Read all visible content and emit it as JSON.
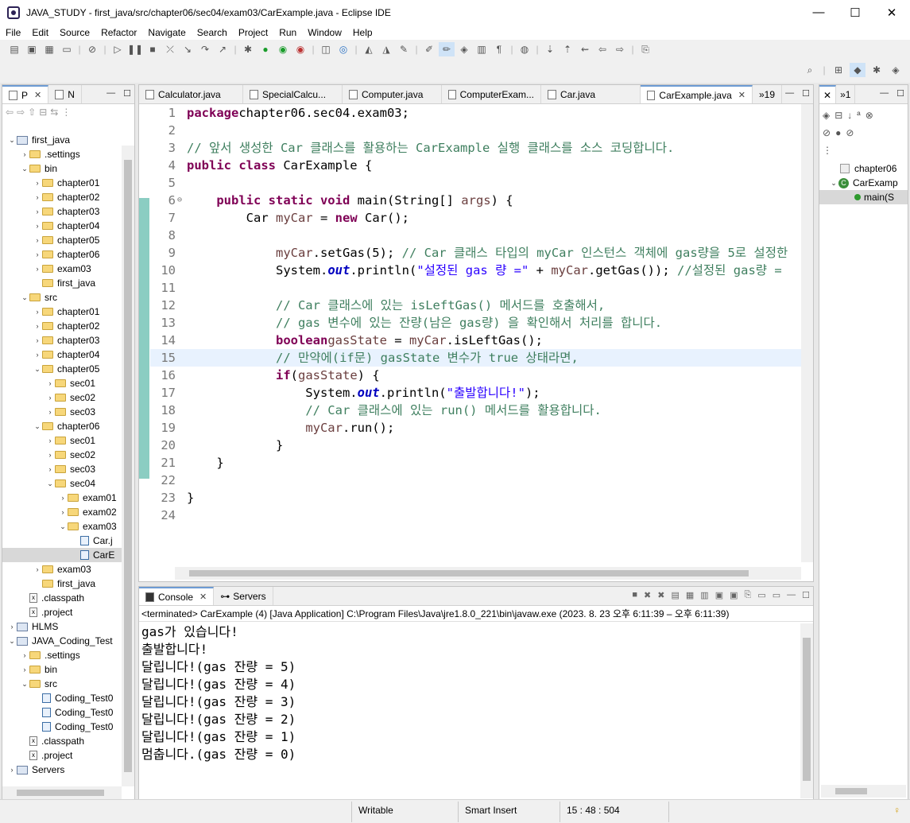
{
  "window": {
    "title": "JAVA_STUDY - first_java/src/chapter06/sec04/exam03/CarExample.java - Eclipse IDE",
    "minimize": "—",
    "maximize": "☐",
    "close": "✕"
  },
  "menu": [
    "File",
    "Edit",
    "Source",
    "Refactor",
    "Navigate",
    "Search",
    "Project",
    "Run",
    "Window",
    "Help"
  ],
  "explorer": {
    "tabs": [
      "P",
      "N"
    ],
    "tree": [
      {
        "label": "first_java",
        "indent": 0,
        "type": "project",
        "tw": "v"
      },
      {
        "label": ".settings",
        "indent": 1,
        "type": "folder",
        "tw": ">"
      },
      {
        "label": "bin",
        "indent": 1,
        "type": "folder",
        "tw": "v"
      },
      {
        "label": "chapter01",
        "indent": 2,
        "type": "folder",
        "tw": ">"
      },
      {
        "label": "chapter02",
        "indent": 2,
        "type": "folder",
        "tw": ">"
      },
      {
        "label": "chapter03",
        "indent": 2,
        "type": "folder",
        "tw": ">"
      },
      {
        "label": "chapter04",
        "indent": 2,
        "type": "folder",
        "tw": ">"
      },
      {
        "label": "chapter05",
        "indent": 2,
        "type": "folder",
        "tw": ">"
      },
      {
        "label": "chapter06",
        "indent": 2,
        "type": "folder",
        "tw": ">"
      },
      {
        "label": "exam03",
        "indent": 2,
        "type": "folder",
        "tw": ">"
      },
      {
        "label": "first_java",
        "indent": 2,
        "type": "folder",
        "tw": ""
      },
      {
        "label": "src",
        "indent": 1,
        "type": "folder",
        "tw": "v"
      },
      {
        "label": "chapter01",
        "indent": 2,
        "type": "folder",
        "tw": ">"
      },
      {
        "label": "chapter02",
        "indent": 2,
        "type": "folder",
        "tw": ">"
      },
      {
        "label": "chapter03",
        "indent": 2,
        "type": "folder",
        "tw": ">"
      },
      {
        "label": "chapter04",
        "indent": 2,
        "type": "folder",
        "tw": ">"
      },
      {
        "label": "chapter05",
        "indent": 2,
        "type": "folder",
        "tw": "v"
      },
      {
        "label": "sec01",
        "indent": 3,
        "type": "folder",
        "tw": ">"
      },
      {
        "label": "sec02",
        "indent": 3,
        "type": "folder",
        "tw": ">"
      },
      {
        "label": "sec03",
        "indent": 3,
        "type": "folder",
        "tw": ">"
      },
      {
        "label": "chapter06",
        "indent": 2,
        "type": "folder",
        "tw": "v"
      },
      {
        "label": "sec01",
        "indent": 3,
        "type": "folder",
        "tw": ">"
      },
      {
        "label": "sec02",
        "indent": 3,
        "type": "folder",
        "tw": ">"
      },
      {
        "label": "sec03",
        "indent": 3,
        "type": "folder",
        "tw": ">"
      },
      {
        "label": "sec04",
        "indent": 3,
        "type": "folder",
        "tw": "v"
      },
      {
        "label": "exam01",
        "indent": 4,
        "type": "folder",
        "tw": ">"
      },
      {
        "label": "exam02",
        "indent": 4,
        "type": "folder",
        "tw": ">"
      },
      {
        "label": "exam03",
        "indent": 4,
        "type": "folder",
        "tw": "v"
      },
      {
        "label": "Car.j",
        "indent": 5,
        "type": "java",
        "tw": ""
      },
      {
        "label": "CarE",
        "indent": 5,
        "type": "java",
        "tw": "",
        "selected": true
      },
      {
        "label": "exam03",
        "indent": 2,
        "type": "folder",
        "tw": ">"
      },
      {
        "label": "first_java",
        "indent": 2,
        "type": "folder",
        "tw": ""
      },
      {
        "label": ".classpath",
        "indent": 1,
        "type": "file",
        "tw": ""
      },
      {
        "label": ".project",
        "indent": 1,
        "type": "file",
        "tw": ""
      },
      {
        "label": "HLMS",
        "indent": 0,
        "type": "project",
        "tw": ">"
      },
      {
        "label": "JAVA_Coding_Test",
        "indent": 0,
        "type": "project",
        "tw": "v"
      },
      {
        "label": ".settings",
        "indent": 1,
        "type": "folder",
        "tw": ">"
      },
      {
        "label": "bin",
        "indent": 1,
        "type": "folder",
        "tw": ">"
      },
      {
        "label": "src",
        "indent": 1,
        "type": "folder",
        "tw": "v"
      },
      {
        "label": "Coding_Test0",
        "indent": 2,
        "type": "java",
        "tw": ""
      },
      {
        "label": "Coding_Test0",
        "indent": 2,
        "type": "java",
        "tw": ""
      },
      {
        "label": "Coding_Test0",
        "indent": 2,
        "type": "java",
        "tw": ""
      },
      {
        "label": ".classpath",
        "indent": 1,
        "type": "file",
        "tw": ""
      },
      {
        "label": ".project",
        "indent": 1,
        "type": "file",
        "tw": ""
      },
      {
        "label": "Servers",
        "indent": 0,
        "type": "project",
        "tw": ">"
      }
    ]
  },
  "editor": {
    "tabs": [
      {
        "label": "Calculator.java",
        "active": false
      },
      {
        "label": "SpecialCalcu...",
        "active": false
      },
      {
        "label": "Computer.java",
        "active": false
      },
      {
        "label": "ComputerExam...",
        "active": false
      },
      {
        "label": "Car.java",
        "active": false
      },
      {
        "label": "CarExample.java",
        "active": true
      }
    ],
    "overflow": "»19",
    "lines": [
      [
        [
          "kw",
          "package"
        ],
        [
          "",
          "chapter06.sec04.exam03;"
        ]
      ],
      [],
      [
        [
          "cm",
          "// 앞서 생성한 Car 클래스를 활용하는 CarExample 실행 클래스를 소스 코딩합니다."
        ]
      ],
      [
        [
          "kw",
          "public class"
        ],
        [
          "",
          " CarExample {"
        ]
      ],
      [],
      [
        [
          "",
          "    "
        ],
        [
          "kw",
          "public static void"
        ],
        [
          "",
          " main(String[] "
        ],
        [
          "vr",
          "args"
        ],
        [
          "",
          ") {"
        ]
      ],
      [
        [
          "",
          "        Car "
        ],
        [
          "vr",
          "myCar"
        ],
        [
          "",
          " = "
        ],
        [
          "kw",
          "new"
        ],
        [
          "",
          " Car();"
        ]
      ],
      [],
      [
        [
          "",
          "            "
        ],
        [
          "vr",
          "myCar"
        ],
        [
          "",
          ".setGas(5); "
        ],
        [
          "cm",
          "// Car 클래스 타입의 myCar 인스턴스 객체에 gas량을 5로 설정한"
        ]
      ],
      [
        [
          "",
          "            System."
        ],
        [
          "fl",
          "out"
        ],
        [
          "",
          ".println("
        ],
        [
          "st",
          "\"설정된 gas 량 =\""
        ],
        [
          "",
          " + "
        ],
        [
          "vr",
          "myCar"
        ],
        [
          "",
          ".getGas()); "
        ],
        [
          "cm",
          "//설정된 gas량 ="
        ]
      ],
      [],
      [
        [
          "",
          "            "
        ],
        [
          "cm",
          "// Car 클래스에 있는 isLeftGas() 메서드를 호출해서,"
        ]
      ],
      [
        [
          "",
          "            "
        ],
        [
          "cm",
          "// gas 변수에 있는 잔량(남은 gas량) 을 확인해서 처리를 합니다."
        ]
      ],
      [
        [
          "",
          "            "
        ],
        [
          "kw",
          "boolean"
        ],
        [
          "",
          "",
          " "
        ],
        [
          "vr",
          "gasState"
        ],
        [
          "",
          " = "
        ],
        [
          "vr",
          "myCar"
        ],
        [
          "",
          ".isLeftGas();"
        ]
      ],
      [
        [
          "",
          "            "
        ],
        [
          "cm",
          "// 만약에(if문) gasState 변수가 true 상태라면,"
        ]
      ],
      [
        [
          "",
          "            "
        ],
        [
          "kw",
          "if"
        ],
        [
          "",
          "("
        ],
        [
          "vr",
          "gasState"
        ],
        [
          "",
          ") {"
        ]
      ],
      [
        [
          "",
          "                System."
        ],
        [
          "fl",
          "out"
        ],
        [
          "",
          ".println("
        ],
        [
          "st",
          "\"출발합니다!\""
        ],
        [
          "",
          ");"
        ]
      ],
      [
        [
          "",
          "                "
        ],
        [
          "cm",
          "// Car 클래스에 있는 run() 메서드를 활용합니다."
        ]
      ],
      [
        [
          "",
          "                "
        ],
        [
          "vr",
          "myCar"
        ],
        [
          "",
          ".run();"
        ]
      ],
      [
        [
          "",
          "            }"
        ]
      ],
      [
        [
          "",
          "    }"
        ]
      ],
      [],
      [
        [
          "",
          "}"
        ]
      ],
      []
    ]
  },
  "outline": {
    "items": [
      {
        "label": "chapter06",
        "kind": "package"
      },
      {
        "label": "CarExamp",
        "kind": "class"
      },
      {
        "label": "main(S",
        "kind": "method"
      }
    ]
  },
  "console": {
    "tabs": [
      "Console",
      "Servers"
    ],
    "header": "<terminated> CarExample (4) [Java Application] C:\\Program Files\\Java\\jre1.8.0_221\\bin\\javaw.exe  (2023. 8. 23 오후 6:11:39 – 오후 6:11:39)",
    "output": [
      "gas가 있습니다!",
      "출발합니다!",
      "달립니다!(gas 잔량 = 5)",
      "달립니다!(gas 잔량 = 4)",
      "달립니다!(gas 잔량 = 3)",
      "달립니다!(gas 잔량 = 2)",
      "달립니다!(gas 잔량 = 1)",
      "멈춥니다.(gas 잔량 = 0)"
    ]
  },
  "status": {
    "writable": "Writable",
    "insert_mode": "Smart Insert",
    "position": "15 : 48 : 504"
  },
  "colors": {
    "keyword": "#7f0055",
    "comment": "#3f7f5f",
    "string": "#2a00ff",
    "field": "#0000c0",
    "variable": "#6a3e3e"
  }
}
